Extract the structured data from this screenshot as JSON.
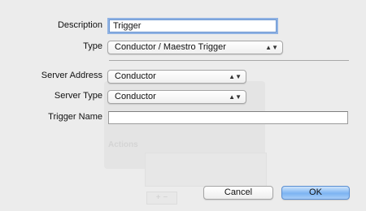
{
  "form": {
    "description": {
      "label": "Description",
      "value": "Trigger"
    },
    "type": {
      "label": "Type",
      "value": "Conductor / Maestro Trigger"
    },
    "server_address": {
      "label": "Server Address",
      "value": "Conductor"
    },
    "server_type": {
      "label": "Server Type",
      "value": "Conductor"
    },
    "trigger_name": {
      "label": "Trigger Name",
      "value": ""
    }
  },
  "background": {
    "actions_label": "Actions",
    "add_remove": "+ −"
  },
  "buttons": {
    "cancel": "Cancel",
    "ok": "OK"
  },
  "colors": {
    "window": "#ececec",
    "focus_ring": "#8fb2e3",
    "default_button": "#7cb4f2"
  },
  "icons": {
    "popup_arrows": "updown-arrows-icon"
  }
}
